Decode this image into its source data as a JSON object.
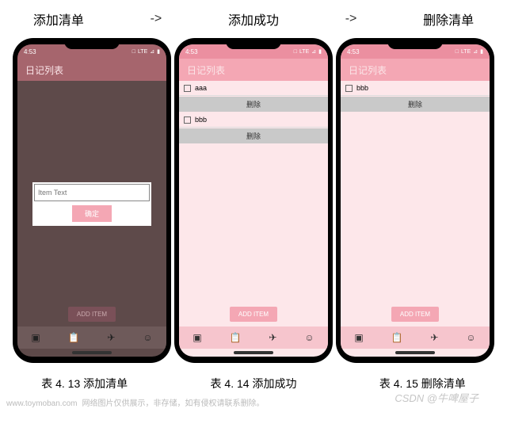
{
  "header": {
    "label1": "添加清单",
    "arrow": "->",
    "label2": "添加成功",
    "label3": "删除清单"
  },
  "status": {
    "time": "4:53",
    "sim": "□",
    "lte": "LTE",
    "signal": "⊿",
    "batt": "▮"
  },
  "app_bar_title": "日记列表",
  "phone1": {
    "modal_placeholder": "Item Text",
    "confirm_label": "确定",
    "add_item_label": "ADD ITEM"
  },
  "phone2": {
    "items": [
      {
        "text": "aaa",
        "del": "删除"
      },
      {
        "text": "bbb",
        "del": "删除"
      }
    ],
    "add_item_label": "ADD ITEM"
  },
  "phone3": {
    "items": [
      {
        "text": "bbb",
        "del": "删除"
      }
    ],
    "add_item_label": "ADD ITEM"
  },
  "nav_icons": {
    "i1": "▣",
    "i2": "📋",
    "i3": "✈",
    "i4": "☺"
  },
  "captions": {
    "c1": "表 4. 13 添加清单",
    "c2": "表 4. 14 添加成功",
    "c3": "表 4. 15 删除清单"
  },
  "watermark": {
    "site": "www.toymoban.com",
    "note": "网络图片仅供展示，非存储，如有侵权请联系删除。",
    "csdn": "CSDN @牛啤屋子"
  }
}
